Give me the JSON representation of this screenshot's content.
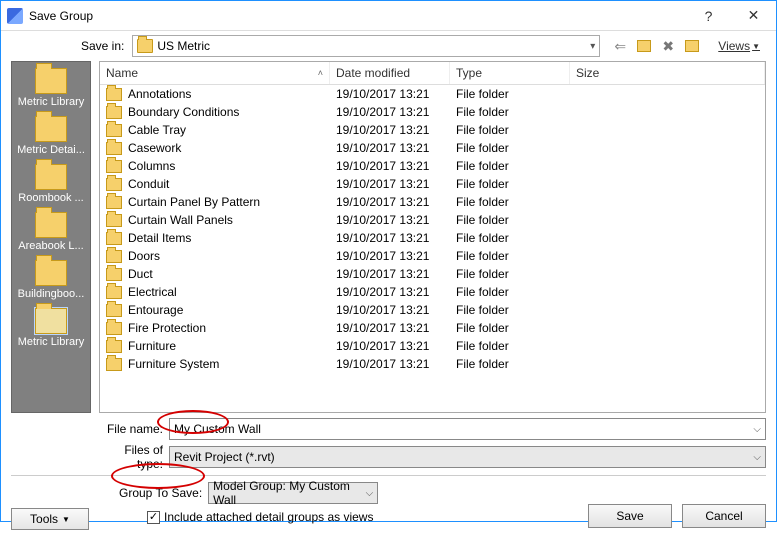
{
  "titlebar": {
    "title": "Save Group"
  },
  "savein": {
    "label": "Save in:",
    "value": "US Metric",
    "views_label": "Views"
  },
  "nav_icons": [
    "back-icon",
    "up-folder-icon",
    "delete-icon",
    "new-folder-icon"
  ],
  "places": [
    {
      "label": "Metric Library"
    },
    {
      "label": "Metric Detai..."
    },
    {
      "label": "Roombook ..."
    },
    {
      "label": "Areabook L..."
    },
    {
      "label": "Buildingboo..."
    },
    {
      "label": "Metric Library",
      "selected": true
    }
  ],
  "columns": {
    "name": "Name",
    "date": "Date modified",
    "type": "Type",
    "size": "Size"
  },
  "rows": [
    {
      "name": "Annotations",
      "date": "19/10/2017 13:21",
      "type": "File folder"
    },
    {
      "name": "Boundary Conditions",
      "date": "19/10/2017 13:21",
      "type": "File folder"
    },
    {
      "name": "Cable Tray",
      "date": "19/10/2017 13:21",
      "type": "File folder"
    },
    {
      "name": "Casework",
      "date": "19/10/2017 13:21",
      "type": "File folder"
    },
    {
      "name": "Columns",
      "date": "19/10/2017 13:21",
      "type": "File folder"
    },
    {
      "name": "Conduit",
      "date": "19/10/2017 13:21",
      "type": "File folder"
    },
    {
      "name": "Curtain Panel By Pattern",
      "date": "19/10/2017 13:21",
      "type": "File folder"
    },
    {
      "name": "Curtain Wall Panels",
      "date": "19/10/2017 13:21",
      "type": "File folder"
    },
    {
      "name": "Detail Items",
      "date": "19/10/2017 13:21",
      "type": "File folder"
    },
    {
      "name": "Doors",
      "date": "19/10/2017 13:21",
      "type": "File folder"
    },
    {
      "name": "Duct",
      "date": "19/10/2017 13:21",
      "type": "File folder"
    },
    {
      "name": "Electrical",
      "date": "19/10/2017 13:21",
      "type": "File folder"
    },
    {
      "name": "Entourage",
      "date": "19/10/2017 13:21",
      "type": "File folder"
    },
    {
      "name": "Fire Protection",
      "date": "19/10/2017 13:21",
      "type": "File folder"
    },
    {
      "name": "Furniture",
      "date": "19/10/2017 13:21",
      "type": "File folder"
    },
    {
      "name": "Furniture System",
      "date": "19/10/2017 13:21",
      "type": "File folder"
    }
  ],
  "form": {
    "filename_label": "File name:",
    "filename_value": "My Custom Wall",
    "filetype_label": "Files of type:",
    "filetype_value": "Revit Project (*.rvt)"
  },
  "group": {
    "label": "Group To Save:",
    "value": "Model Group: My Custom Wall",
    "checkbox_label": "Include attached detail groups as views",
    "checked": true
  },
  "buttons": {
    "tools": "Tools",
    "save": "Save",
    "cancel": "Cancel"
  }
}
